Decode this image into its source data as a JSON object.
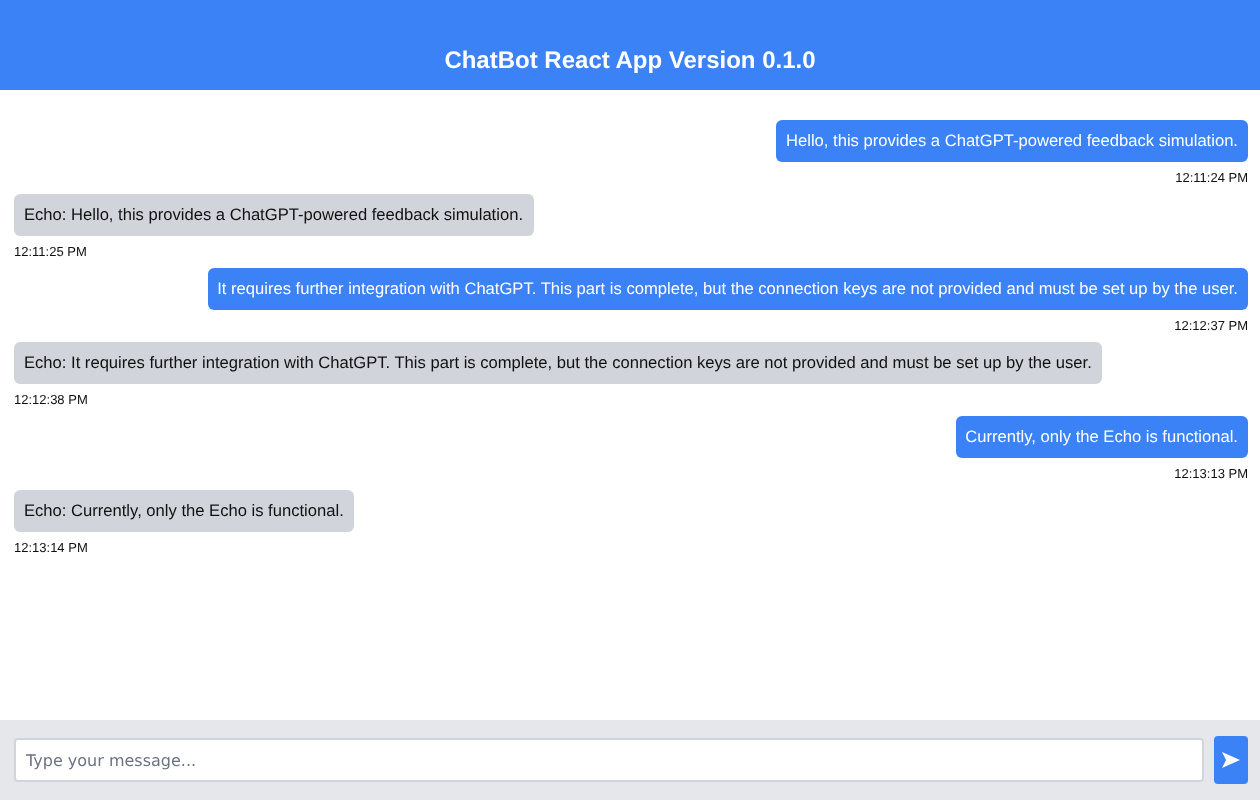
{
  "header": {
    "title": "ChatBot React App Version 0.1.0"
  },
  "messages": [
    {
      "kind": "user",
      "text": "Hello, this provides a ChatGPT-powered feedback simulation.",
      "time": "12:11:24 PM"
    },
    {
      "kind": "bot",
      "text": "Echo: Hello, this provides a ChatGPT-powered feedback simulation.",
      "time": "12:11:25 PM"
    },
    {
      "kind": "user",
      "text": "It requires further integration with ChatGPT. This part is complete, but the connection keys are not provided and must be set up by the user.",
      "time": "12:12:37 PM"
    },
    {
      "kind": "bot",
      "text": "Echo: It requires further integration with ChatGPT. This part is complete, but the connection keys are not provided and must be set up by the user.",
      "time": "12:12:38 PM"
    },
    {
      "kind": "user",
      "text": "Currently, only the Echo is functional.",
      "time": "12:13:13 PM"
    },
    {
      "kind": "bot",
      "text": "Echo: Currently, only the Echo is functional.",
      "time": "12:13:14 PM"
    }
  ],
  "composer": {
    "placeholder": "Type your message..."
  }
}
